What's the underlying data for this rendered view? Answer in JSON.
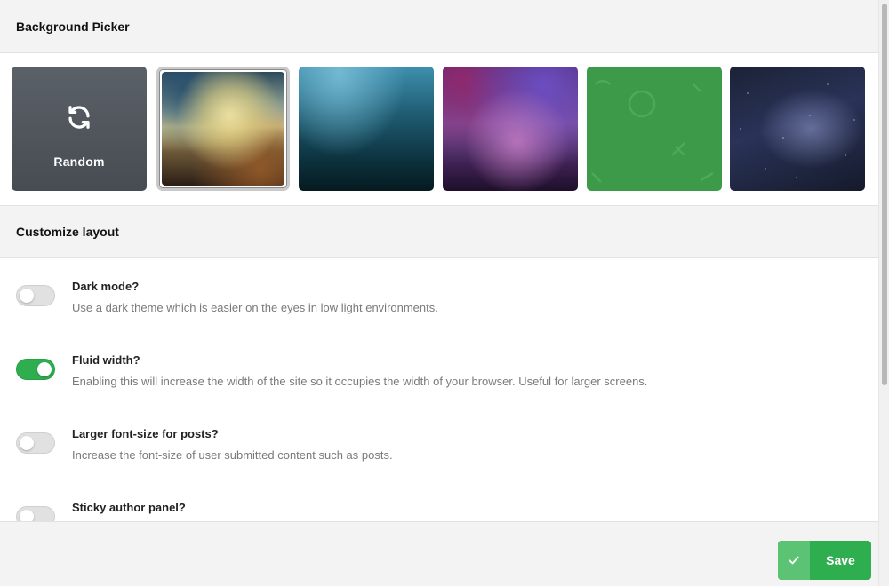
{
  "background_picker": {
    "title": "Background Picker",
    "random_label": "Random",
    "tiles": [
      {
        "name": "random",
        "selected": false
      },
      {
        "name": "blurred-landscape",
        "selected": true
      },
      {
        "name": "teal-gradient",
        "selected": false
      },
      {
        "name": "purple-gradient",
        "selected": false
      },
      {
        "name": "green-pattern",
        "selected": false
      },
      {
        "name": "milky-way",
        "selected": false
      }
    ]
  },
  "customize_layout": {
    "title": "Customize layout",
    "settings": [
      {
        "title": "Dark mode?",
        "description": "Use a dark theme which is easier on the eyes in low light environments.",
        "enabled": false
      },
      {
        "title": "Fluid width?",
        "description": "Enabling this will increase the width of the site so it occupies the width of your browser. Useful for larger screens.",
        "enabled": true
      },
      {
        "title": "Larger font-size for posts?",
        "description": "Increase the font-size of user submitted content such as posts.",
        "enabled": false
      },
      {
        "title": "Sticky author panel?",
        "description": "",
        "enabled": false
      }
    ]
  },
  "footer": {
    "save_label": "Save"
  },
  "colors": {
    "accent_green": "#2fae4f",
    "header_bg": "#f3f3f3"
  }
}
